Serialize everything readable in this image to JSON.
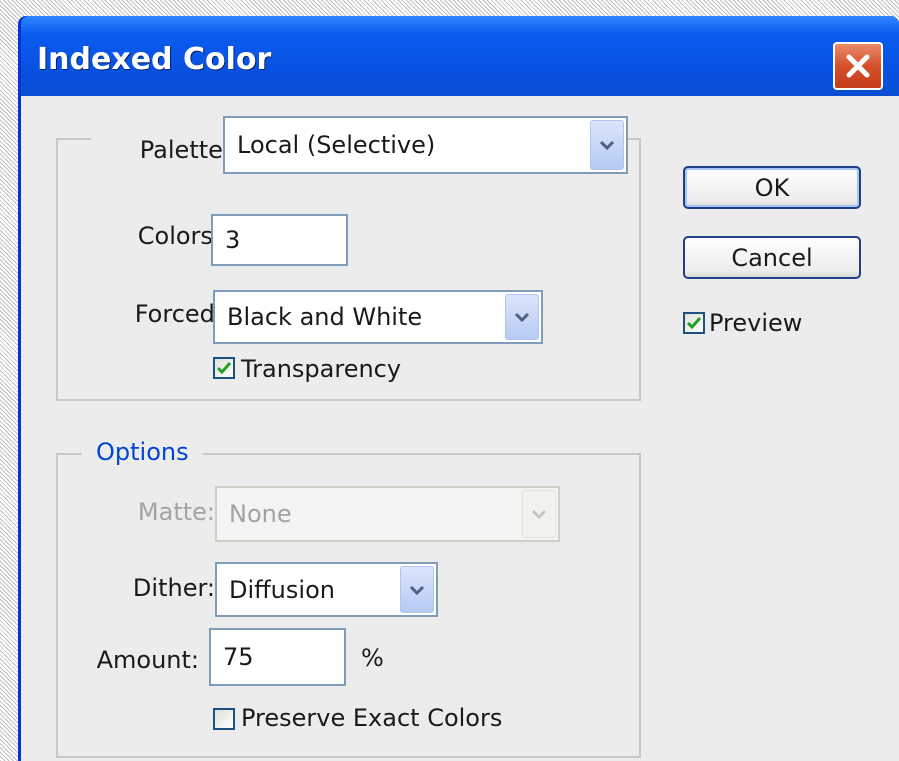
{
  "window": {
    "title": "Indexed Color"
  },
  "palette_group": {
    "palette_label": "Palette:",
    "palette_value": "Local (Selective)",
    "colors_label": "Colors:",
    "colors_value": "3",
    "forced_label": "Forced:",
    "forced_value": "Black and White",
    "transparency_label": "Transparency",
    "transparency_checked": true
  },
  "options_group": {
    "legend": "Options",
    "matte_label": "Matte:",
    "matte_value": "None",
    "matte_enabled": false,
    "dither_label": "Dither:",
    "dither_value": "Diffusion",
    "amount_label": "Amount:",
    "amount_value": "75",
    "amount_unit": "%",
    "preserve_label": "Preserve Exact Colors",
    "preserve_checked": false
  },
  "buttons": {
    "ok_label": "OK",
    "cancel_label": "Cancel"
  },
  "preview": {
    "label": "Preview",
    "checked": true
  },
  "icons": {
    "close": "close-icon",
    "dropdown": "chevron-down-icon",
    "check": "check-icon"
  },
  "colors": {
    "titlebar": "#0a5bf0",
    "dialog_bg": "#ececec",
    "legend_text": "#0046d5",
    "close_button": "#d6502c",
    "checkmark": "#21a121"
  }
}
